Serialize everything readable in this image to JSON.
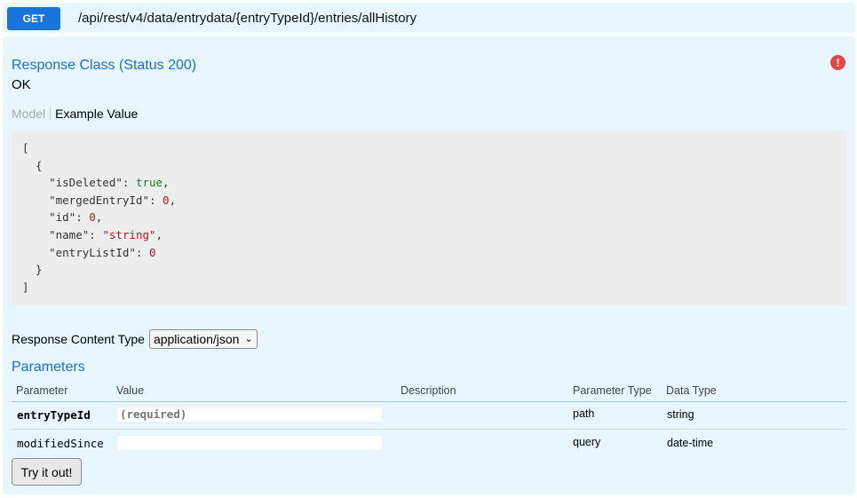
{
  "header": {
    "method": "GET",
    "path": "/api/rest/v4/data/entrydata/{entryTypeId}/entries/allHistory"
  },
  "response": {
    "title": "Response Class (Status 200)",
    "status_text": "OK",
    "tabs": {
      "model": "Model",
      "example": "Example Value"
    },
    "example_lines": [
      [
        {
          "t": "[",
          "c": "k"
        }
      ],
      [
        {
          "t": "  {",
          "c": "k"
        }
      ],
      [
        {
          "t": "    \"isDeleted\": ",
          "c": "k"
        },
        {
          "t": "true",
          "c": "b"
        },
        {
          "t": ",",
          "c": "k"
        }
      ],
      [
        {
          "t": "    \"mergedEntryId\": ",
          "c": "k"
        },
        {
          "t": "0",
          "c": "n"
        },
        {
          "t": ",",
          "c": "k"
        }
      ],
      [
        {
          "t": "    \"id\": ",
          "c": "k"
        },
        {
          "t": "0",
          "c": "n"
        },
        {
          "t": ",",
          "c": "k"
        }
      ],
      [
        {
          "t": "    \"name\": ",
          "c": "k"
        },
        {
          "t": "\"string\"",
          "c": "s"
        },
        {
          "t": ",",
          "c": "k"
        }
      ],
      [
        {
          "t": "    \"entryListId\": ",
          "c": "k"
        },
        {
          "t": "0",
          "c": "n"
        }
      ],
      [
        {
          "t": "  }",
          "c": "k"
        }
      ],
      [
        {
          "t": "]",
          "c": "k"
        }
      ]
    ],
    "content_type_label": "Response Content Type",
    "content_type_value": "application/json"
  },
  "icons": {
    "error": "error-icon",
    "dropdown": "chevron-down-icon"
  },
  "colors": {
    "method_bg": "#1a73d9",
    "section_title": "#1a6fcd",
    "panel_bg": "#e7f6fd",
    "error": "#e34646"
  },
  "parameters": {
    "title": "Parameters",
    "columns": [
      "Parameter",
      "Value",
      "Description",
      "Parameter Type",
      "Data Type"
    ],
    "rows": [
      {
        "name": "entryTypeId",
        "value": "",
        "placeholder": "(required)",
        "description": "",
        "param_type": "path",
        "data_type": "string"
      },
      {
        "name": "modifiedSince",
        "value": "",
        "placeholder": "",
        "description": "",
        "param_type": "query",
        "data_type": "date-time"
      }
    ]
  },
  "try_button": "Try it out!"
}
